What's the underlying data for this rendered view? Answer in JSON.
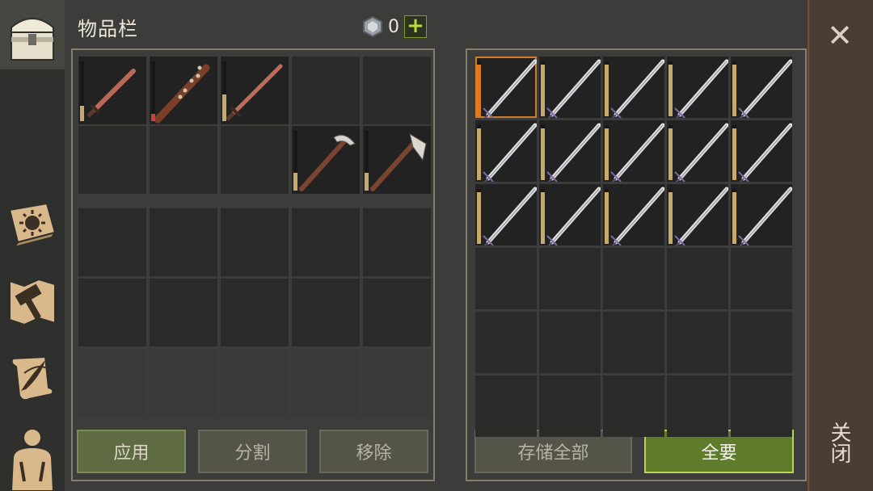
{
  "header": {
    "title": "物品栏",
    "currency_icon": "gem-icon",
    "currency_value": "0",
    "add_icon": "plus-icon"
  },
  "sidebar": {
    "tabs": [
      {
        "name": "inventory-chest",
        "icon": "chest-icon",
        "active": true
      },
      {
        "name": "skills-book",
        "icon": "sun-book-icon",
        "active": false
      },
      {
        "name": "crafting-map",
        "icon": "hammer-map-icon",
        "active": false
      },
      {
        "name": "quests-scroll",
        "icon": "scroll-quill-icon",
        "active": false
      },
      {
        "name": "character-equipment",
        "icon": "character-silhouette-icon",
        "active": false
      }
    ]
  },
  "inventory": {
    "columns": 5,
    "rows": 6,
    "slots": [
      {
        "item": "short-sword",
        "durability": 0.25
      },
      {
        "item": "spiked-club",
        "durability": 0.12,
        "durability_color": "#d23c3c"
      },
      {
        "item": "long-sword",
        "durability": 0.45
      },
      {
        "item": null
      },
      {
        "item": null
      },
      {
        "item": null
      },
      {
        "item": null
      },
      {
        "item": null
      },
      {
        "item": "pickaxe",
        "durability": 0.3
      },
      {
        "item": "hatchet",
        "durability": 0.3
      },
      {
        "item": null
      },
      {
        "item": null
      },
      {
        "item": null
      },
      {
        "item": null
      },
      {
        "item": null
      },
      {
        "item": null
      },
      {
        "item": null
      },
      {
        "item": null
      },
      {
        "item": null
      },
      {
        "item": null
      },
      {
        "item": null,
        "locked": true
      },
      {
        "item": null,
        "locked": true
      },
      {
        "item": null,
        "locked": true
      },
      {
        "item": null,
        "locked": true
      },
      {
        "item": null,
        "locked": true
      }
    ]
  },
  "storage": {
    "columns": 5,
    "rows": 6,
    "filled": 15,
    "item": "steel-sword",
    "durabilities": [
      0.95,
      0.95,
      0.95,
      0.95,
      0.95,
      0.95,
      0.95,
      0.95,
      0.95,
      0.95,
      0.95,
      0.95,
      0.95,
      0.95,
      0.95
    ],
    "first_durability_color": "#e07a20",
    "selected_index": 0
  },
  "buttons": {
    "apply": "应用",
    "split": "分割",
    "remove": "移除",
    "store_all": "存储全部",
    "take_all": "全要"
  },
  "close": {
    "icon": "close-icon",
    "label": "关闭"
  }
}
